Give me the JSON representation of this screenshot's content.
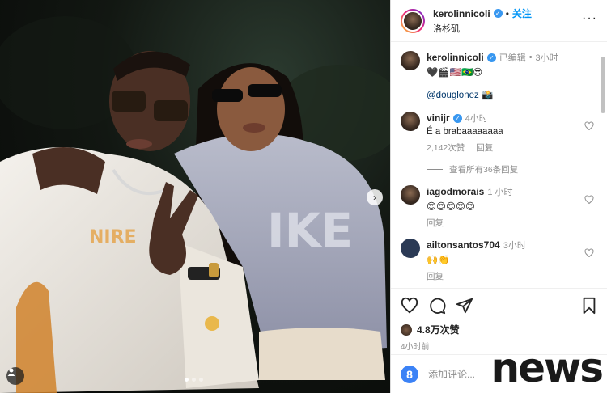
{
  "post": {
    "author": "kerolinnicoli",
    "follow_label": "关注",
    "location": "洛杉矶",
    "more_label": "···"
  },
  "caption": {
    "username": "kerolinnicoli",
    "edited": "已编辑",
    "time": "3小时",
    "text": "🖤🎬🇺🇸🇧🇷😎",
    "mention": "@douglonez 📸"
  },
  "comments": [
    {
      "username": "vinijr",
      "time": "4小时",
      "text": "É a brabaaaaaaaa",
      "likes": "2,142次赞",
      "reply": "回复",
      "verified": true
    },
    {
      "username": "iagodmorais",
      "time": "1 小时",
      "text": "😍😍😍😍😍",
      "reply": "回复",
      "verified": false
    },
    {
      "username": "ailtonsantos704",
      "time": "3小时",
      "text": "🙌👏",
      "reply": "回复",
      "verified": false
    }
  ],
  "view_replies": "查看所有36条回复",
  "likes_count": "4.8万次赞",
  "post_time": "4小时前",
  "comment_placeholder": "添加评论...",
  "emoji_button_glyph": "8",
  "watermark": "news",
  "carousel": {
    "slides": 3,
    "current": 1
  },
  "colors": {
    "link": "#0095f6",
    "verified": "#3897f0",
    "muted": "#8e8e8e"
  }
}
